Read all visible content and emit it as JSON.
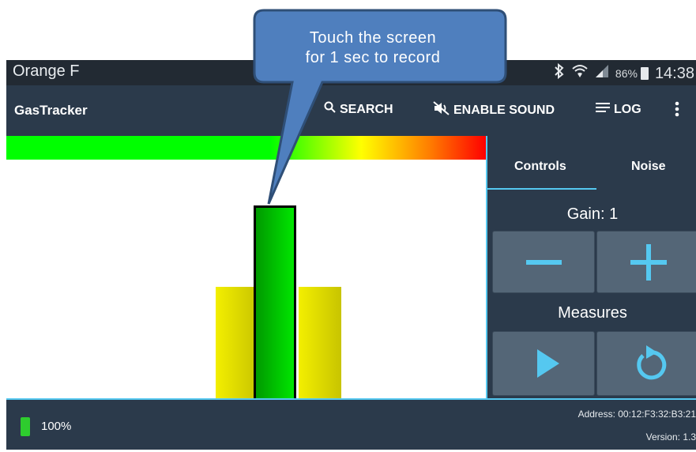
{
  "status_bar": {
    "carrier": "Orange F",
    "battery_percent": "86%",
    "time": "14:38",
    "icons": [
      "bluetooth-icon",
      "wifi-icon",
      "signal-icon",
      "battery-icon"
    ]
  },
  "app_bar": {
    "title": "GasTracker",
    "actions": [
      {
        "label": "SEARCH",
        "icon": "search-icon"
      },
      {
        "label": "ENABLE SOUND",
        "icon": "sound-off-icon"
      },
      {
        "label": "LOG",
        "icon": "list-icon"
      }
    ],
    "overflow_icon": "more-vert-icon"
  },
  "callout": {
    "line1": "Touch the screen",
    "line2": "for 1 sec to record"
  },
  "level_meter": {
    "colors": [
      "#00ff00",
      "#ffff00",
      "#ff8000",
      "#ff0000"
    ]
  },
  "bars": {
    "side_color": "#e6e000",
    "center_color": "#00cc00"
  },
  "panel": {
    "tabs": [
      "Controls",
      "Noise"
    ],
    "active_tab": "Controls",
    "gain_label": "Gain: 1",
    "measures_label": "Measures",
    "accent_color": "#55c8f0"
  },
  "bottom_bar": {
    "battery": "100%",
    "address": "Address: 00:12:F3:32:B3:21",
    "version": "Version: 1.3"
  }
}
